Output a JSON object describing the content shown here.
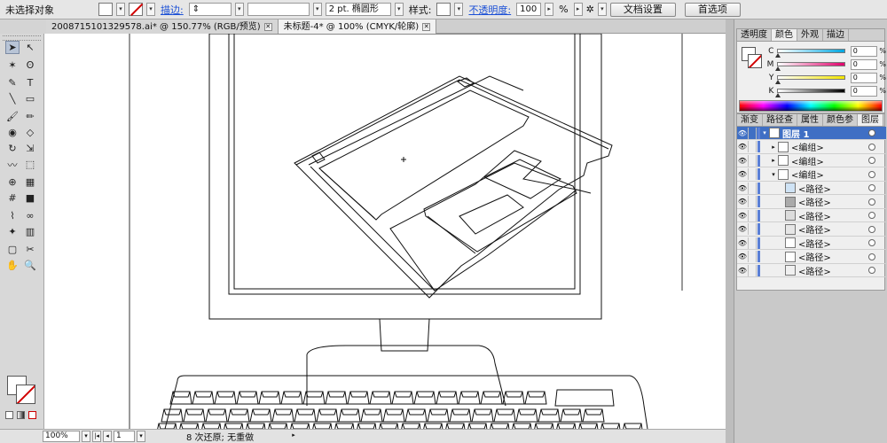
{
  "control_bar": {
    "selection_state": "未选择对象",
    "stroke_label": "描边:",
    "stroke_profile": "2 pt. 椭圆形",
    "style_label": "样式:",
    "opacity_label": "不透明度:",
    "opacity_value": "100",
    "opacity_unit": "%",
    "doc_setup_button": "文档设置",
    "preferences_button": "首选项"
  },
  "tabs": [
    {
      "label": "20087151013295​78.ai* @ 150.77% (RGB/预览)",
      "active": false
    },
    {
      "label": "未标题-4* @ 100% (CMYK/轮廓)",
      "active": true
    }
  ],
  "color_panel": {
    "tabs": [
      "透明度",
      "颜色",
      "外观",
      "描边"
    ],
    "active_tab": "颜色",
    "channels": [
      {
        "name": "C",
        "value": "0",
        "unit": "%",
        "color": "#00a6e0"
      },
      {
        "name": "M",
        "value": "0",
        "unit": "%",
        "color": "#e0006b"
      },
      {
        "name": "Y",
        "value": "0",
        "unit": "%",
        "color": "#f3e600"
      },
      {
        "name": "K",
        "value": "0",
        "unit": "%",
        "color": "#000000"
      }
    ]
  },
  "layers_panel": {
    "tabs": [
      "渐变",
      "路径查",
      "属性",
      "颜色参",
      "图层"
    ],
    "active_tab": "图层",
    "rows": [
      {
        "label": "图层 1",
        "type": "layer",
        "selected": true
      },
      {
        "label": "<编组>",
        "type": "group"
      },
      {
        "label": "<编组>",
        "type": "group"
      },
      {
        "label": "<编组>",
        "type": "group"
      },
      {
        "label": "<路径>",
        "type": "path"
      },
      {
        "label": "<路径>",
        "type": "path"
      },
      {
        "label": "<路径>",
        "type": "path"
      },
      {
        "label": "<路径>",
        "type": "path"
      },
      {
        "label": "<路径>",
        "type": "path"
      },
      {
        "label": "<路径>",
        "type": "path"
      },
      {
        "label": "<路径>",
        "type": "path"
      }
    ]
  },
  "status_bar": {
    "zoom": "100%",
    "artboard": "1",
    "message": "8 次还原; 无重做"
  },
  "tool_icons": [
    "selection-tool-icon",
    "direct-selection-tool-icon",
    "magic-wand-tool-icon",
    "lasso-tool-icon",
    "pen-tool-icon",
    "type-tool-icon",
    "line-tool-icon",
    "rectangle-tool-icon",
    "paintbrush-tool-icon",
    "pencil-tool-icon",
    "blob-brush-tool-icon",
    "eraser-tool-icon",
    "rotate-tool-icon",
    "scale-tool-icon",
    "warp-tool-icon",
    "free-transform-tool-icon",
    "shape-builder-tool-icon",
    "perspective-grid-tool-icon",
    "mesh-tool-icon",
    "gradient-tool-icon",
    "eyedropper-tool-icon",
    "blend-tool-icon",
    "symbol-sprayer-tool-icon",
    "column-graph-tool-icon",
    "artboard-tool-icon",
    "slice-tool-icon",
    "hand-tool-icon",
    "zoom-tool-icon"
  ]
}
